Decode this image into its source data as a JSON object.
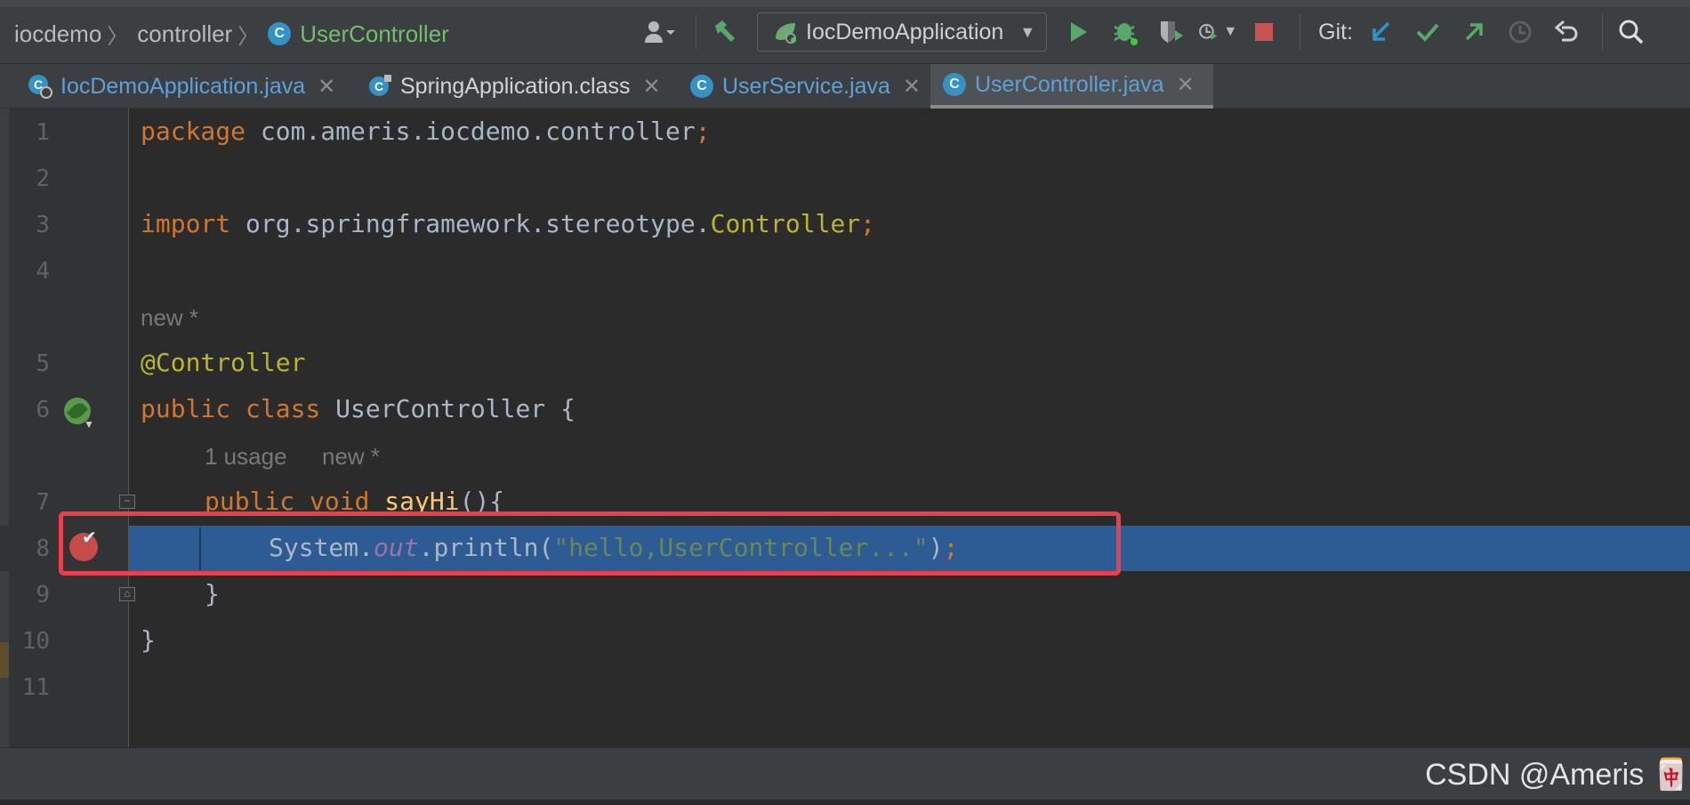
{
  "breadcrumbs": {
    "items": [
      "iocdemo",
      "controller",
      "UserController"
    ]
  },
  "toolbar": {
    "run_config": "IocDemoApplication",
    "git_label": "Git:",
    "icons": [
      "profile-icon",
      "build-hammer-icon",
      "run-icon",
      "debug-icon",
      "coverage-icon",
      "profiler-icon",
      "stop-icon",
      "git-update-icon",
      "git-commit-icon",
      "git-push-icon",
      "history-icon",
      "rollback-icon",
      "search-icon"
    ]
  },
  "tabs": [
    {
      "label": "IocDemoApplication.java",
      "color": "#5fa0d6"
    },
    {
      "label": "SpringApplication.class",
      "color": "#d4d4d4"
    },
    {
      "label": "UserService.java",
      "color": "#5fa0d6"
    },
    {
      "label": "UserController.java",
      "color": "#5fa0d6",
      "active": true
    }
  ],
  "editor": {
    "line_numbers": [
      "1",
      "2",
      "3",
      "4",
      "5",
      "6",
      "7",
      "8",
      "9",
      "10",
      "11"
    ],
    "line1": {
      "kw": "package",
      "pkg": " com.ameris.iocdemo.controller",
      "semi": ";"
    },
    "line3": {
      "kw": "import",
      "pkg": " org.springframework.stereotype.",
      "cls": "Controller",
      "semi": ";"
    },
    "hint_new1": "new *",
    "line5": {
      "ann": "@Controller"
    },
    "line6": {
      "kw": "public class",
      "name": " UserController {"
    },
    "hint_usage": "1 usage",
    "hint_new2": "new *",
    "line7": {
      "kw": "public void",
      "fn": "sayHi",
      "rest": "(){"
    },
    "line8": {
      "pre": "System.",
      "fld": "out",
      "mid": ".println(",
      "str": "\"hello,UserController...\"",
      "end": ")",
      "semi": ";"
    },
    "line9": "}",
    "line10": "}"
  },
  "status": {
    "watermark": "CSDN @Ameris 🀄"
  },
  "colors": {
    "accent_highlight": "#2d5b93",
    "breakpoint": "#c74b48",
    "red_box": "#e8404c"
  }
}
